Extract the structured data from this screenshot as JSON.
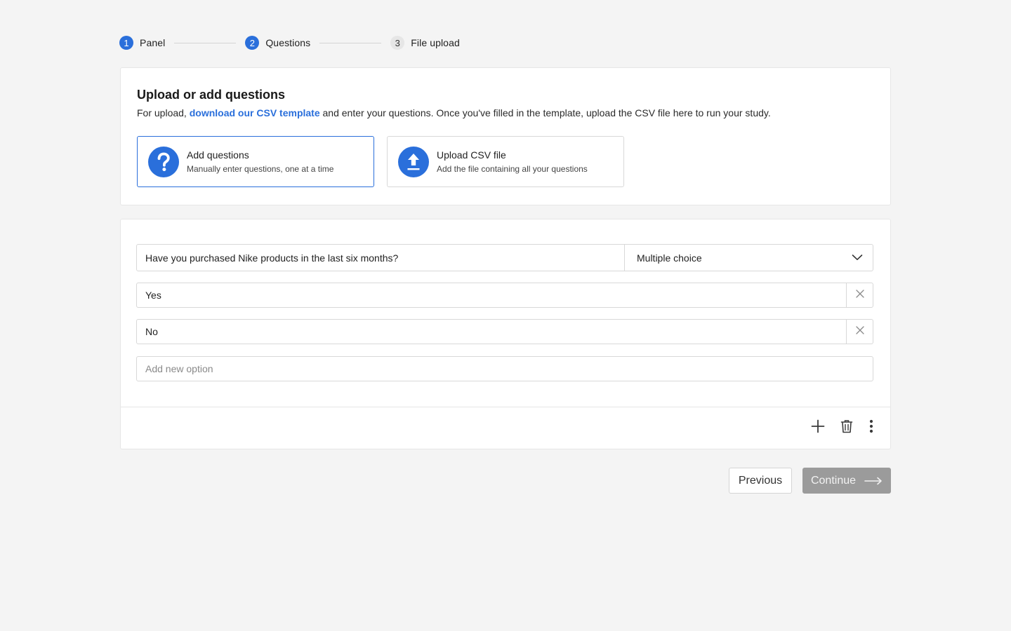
{
  "stepper": {
    "steps": [
      {
        "number": "1",
        "label": "Panel",
        "state": "active"
      },
      {
        "number": "2",
        "label": "Questions",
        "state": "active"
      },
      {
        "number": "3",
        "label": "File upload",
        "state": "pending"
      }
    ]
  },
  "upload_card": {
    "title": "Upload or add questions",
    "desc_prefix": "For upload, ",
    "desc_link": "download our CSV template",
    "desc_suffix": " and enter your questions. Once you've filled in the template, upload the CSV file here to run your study.",
    "options": [
      {
        "title": "Add questions",
        "subtitle": "Manually enter questions, one at a time",
        "icon": "question-mark-icon",
        "selected": true
      },
      {
        "title": "Upload CSV file",
        "subtitle": "Add the file containing all your questions",
        "icon": "upload-icon",
        "selected": false
      }
    ]
  },
  "question_card": {
    "question_text": "Have you purchased Nike products in the last six months?",
    "question_type": "Multiple choice",
    "answers": [
      "Yes",
      "No"
    ],
    "new_option_placeholder": "Add new option",
    "tools": [
      "plus-icon",
      "trash-icon",
      "more-vertical-icon"
    ]
  },
  "footer": {
    "previous_label": "Previous",
    "continue_label": "Continue"
  },
  "colors": {
    "accent": "#2a6fdb",
    "background": "#f4f4f4",
    "disabled_button": "#9b9b9b"
  }
}
